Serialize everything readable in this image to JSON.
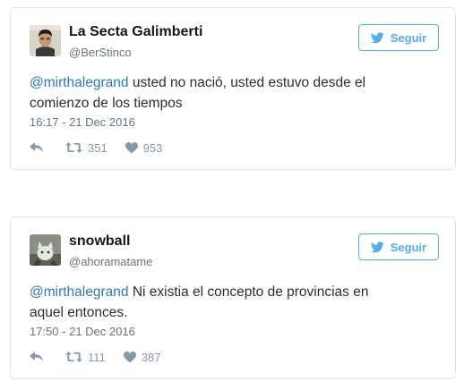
{
  "tweets": [
    {
      "display_name": "La Secta Galimberti",
      "handle": "@BerStinco",
      "follow_label": "Seguir",
      "mention": "@mirthalegrand",
      "text": " usted no nació, usted estuvo desde el comienzo de los tiempos",
      "timestamp": "16:17 - 21 Dec 2016",
      "retweets": "351",
      "likes": "953"
    },
    {
      "display_name": "snowball",
      "handle": "@ahoramatame",
      "follow_label": "Seguir",
      "mention": "@mirthalegrand",
      "text": " Ni existia el concepto de provincias en aquel entonces.",
      "timestamp": "17:50 - 21 Dec 2016",
      "retweets": "111",
      "likes": "387"
    }
  ],
  "icons": {
    "follow": "twitter-bird-icon",
    "reply": "reply-arrow-icon",
    "retweet": "retweet-icon",
    "like": "heart-icon"
  },
  "colors": {
    "accent": "#55acee",
    "mention": "#2b7bb9",
    "muted": "#66757f",
    "action": "#8899a6",
    "border": "#e1e8ed"
  }
}
